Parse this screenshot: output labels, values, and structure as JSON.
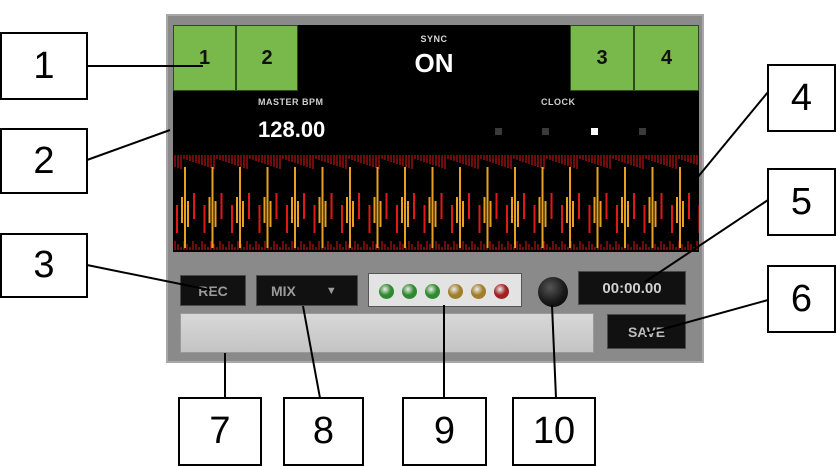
{
  "decks": {
    "deck1": "1",
    "deck2": "2",
    "deck3": "3",
    "deck4": "4"
  },
  "sync": {
    "label": "SYNC",
    "value": "ON"
  },
  "master_bpm": {
    "label": "MASTER BPM",
    "value": "128.00"
  },
  "clock": {
    "label": "CLOCK",
    "active_step": 3,
    "steps": 4
  },
  "controls": {
    "rec_label": "REC",
    "mix_label": "MIX",
    "mix_arrow": "▼",
    "timer": "00:00.00",
    "save_label": "SAVE"
  },
  "level_leds": {
    "colors": [
      "#2f8a2f",
      "#2f8a2f",
      "#2f8a2f",
      "#a07e2a",
      "#a07e2a",
      "#a12020"
    ]
  },
  "callouts": [
    "1",
    "2",
    "3",
    "4",
    "5",
    "6",
    "7",
    "8",
    "9",
    "10"
  ],
  "colors": {
    "deck_green": "#79b84b",
    "wave_orange": "#e8a020",
    "wave_red": "#e01818"
  }
}
